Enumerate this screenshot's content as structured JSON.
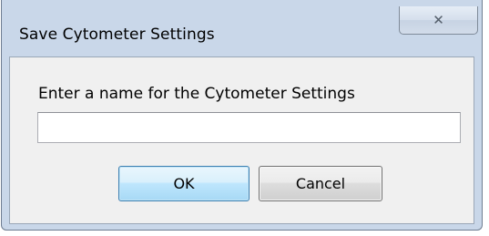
{
  "window": {
    "title": "Save Cytometer Settings",
    "close_symbol": "✕",
    "close_icon": "close-icon"
  },
  "form": {
    "prompt": "Enter a name for the Cytometer Settings",
    "name_value": "",
    "name_placeholder": ""
  },
  "buttons": {
    "ok_label": "OK",
    "cancel_label": "Cancel"
  },
  "colors": {
    "frame": "#c9d7e9",
    "client": "#f0f0f0",
    "ok_accent": "#3c7fb1"
  }
}
